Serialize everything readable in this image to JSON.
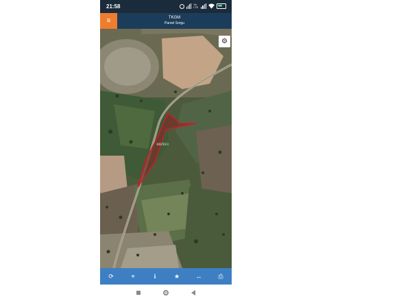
{
  "status_bar": {
    "time": "21:58",
    "volte_label": "Vo LTE",
    "battery_level": "50"
  },
  "header": {
    "menu_icon": "hamburger-icon",
    "title": "TKGM",
    "subtitle": "Parsel Sorgu"
  },
  "map": {
    "settings_icon": "gear-icon",
    "parcel_label": "103/93/3"
  },
  "toolbar": {
    "buttons": [
      {
        "name": "refresh",
        "icon": "refresh-icon",
        "glyph": "⟳"
      },
      {
        "name": "locate",
        "icon": "crosshair-icon",
        "glyph": "⌖"
      },
      {
        "name": "info",
        "icon": "info-icon",
        "glyph": "i"
      },
      {
        "name": "favorite",
        "icon": "star-icon",
        "glyph": "★"
      },
      {
        "name": "measure",
        "icon": "measure-icon",
        "glyph": "↔"
      },
      {
        "name": "print",
        "icon": "print-icon",
        "glyph": "⎙"
      }
    ]
  },
  "colors": {
    "status_bar": "#1a2b3b",
    "header": "#1c3d5a",
    "menu_button": "#f07c2e",
    "toolbar": "#3e7fc4",
    "parcel_outline": "#c4202a"
  }
}
